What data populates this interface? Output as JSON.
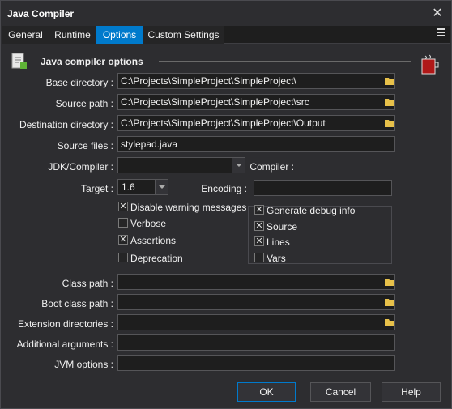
{
  "window": {
    "title": "Java Compiler"
  },
  "tabs": [
    {
      "label": "General"
    },
    {
      "label": "Runtime"
    },
    {
      "label": "Options"
    },
    {
      "label": "Custom Settings"
    }
  ],
  "section": {
    "title": "Java compiler options"
  },
  "fields": {
    "base_directory": {
      "label": "Base directory :",
      "value": "C:\\Projects\\SimpleProject\\SimpleProject\\"
    },
    "source_path": {
      "label": "Source path :",
      "value": "C:\\Projects\\SimpleProject\\SimpleProject\\src"
    },
    "destination_directory": {
      "label": "Destination  directory :",
      "value": "C:\\Projects\\SimpleProject\\SimpleProject\\Output"
    },
    "source_files": {
      "label": "Source files :",
      "value": "stylepad.java"
    },
    "jdk_compiler": {
      "label": "JDK/Compiler :",
      "value": ""
    },
    "compiler": {
      "label": "Compiler :"
    },
    "target": {
      "label": "Target :",
      "value": "1.6"
    },
    "encoding": {
      "label": "Encoding :",
      "value": ""
    },
    "class_path": {
      "label": "Class path :",
      "value": ""
    },
    "boot_class_path": {
      "label": "Boot class path :",
      "value": ""
    },
    "extension_directories": {
      "label": "Extension directories :",
      "value": ""
    },
    "additional_arguments": {
      "label": "Additional arguments :",
      "value": ""
    },
    "jvm_options": {
      "label": "JVM options :",
      "value": ""
    }
  },
  "checkboxes_left": [
    {
      "label": "Disable warning messages",
      "checked": true
    },
    {
      "label": "Verbose",
      "checked": false
    },
    {
      "label": "Assertions",
      "checked": true
    },
    {
      "label": "Deprecation",
      "checked": false
    }
  ],
  "debug": {
    "label": "Generate debug info",
    "checked": true,
    "items": [
      {
        "label": "Source",
        "checked": true
      },
      {
        "label": "Lines",
        "checked": true
      },
      {
        "label": "Vars",
        "checked": false
      }
    ]
  },
  "buttons": {
    "ok": "OK",
    "cancel": "Cancel",
    "help": "Help"
  },
  "colors": {
    "accent": "#007acc",
    "background": "#2d2d30",
    "field": "#1e1e1e",
    "folder": "#e8c14a"
  }
}
